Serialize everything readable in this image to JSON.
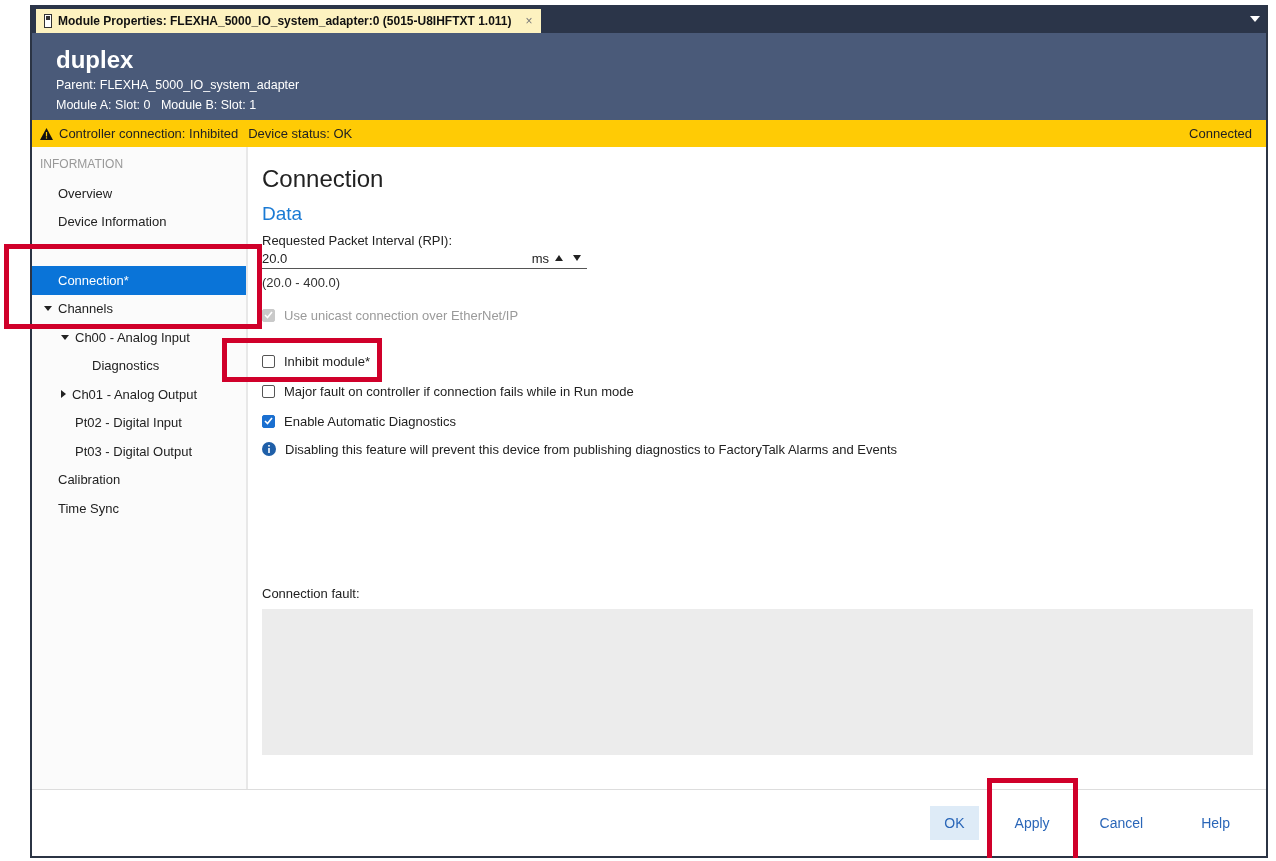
{
  "tab": {
    "title": "Module Properties:  FLEXHA_5000_IO_system_adapter:0 (5015-U8IHFTXT 1.011)",
    "close": "×"
  },
  "header": {
    "title": "duplex",
    "parent": "Parent: FLEXHA_5000_IO_system_adapter",
    "slots": "Module A: Slot: 0   Module B: Slot: 1"
  },
  "banner": {
    "controller": "Controller connection: Inhibited",
    "device": "Device status: OK",
    "connection": "Connected"
  },
  "sidebar": {
    "section": "INFORMATION",
    "items": [
      {
        "label": "Overview",
        "selected": false,
        "highlighted": false
      },
      {
        "label": "Device Information",
        "selected": false,
        "highlighted": false
      },
      {
        "label": "Connection*",
        "selected": true,
        "highlighted": true
      },
      {
        "label": "Channels",
        "selected": false,
        "highlighted": false,
        "expanded": true,
        "children": [
          {
            "label": "Ch00 - Analog Input",
            "selected": false,
            "highlighted": false,
            "expanded": true,
            "children": [
              {
                "label": "Diagnostics",
                "selected": false,
                "highlighted": false
              }
            ]
          },
          {
            "label": "Ch01 - Analog Output",
            "selected": false,
            "highlighted": false,
            "expanded": false
          },
          {
            "label": "Pt02 - Digital Input",
            "selected": false,
            "highlighted": false
          },
          {
            "label": "Pt03 - Digital Output",
            "selected": false,
            "highlighted": false
          }
        ]
      },
      {
        "label": "Calibration",
        "selected": false,
        "highlighted": false
      },
      {
        "label": "Time Sync",
        "selected": false,
        "highlighted": false
      }
    ]
  },
  "content": {
    "title": "Connection",
    "section": "Data",
    "rpi": {
      "label": "Requested Packet Interval (RPI):",
      "value": "20.0",
      "unit": "ms",
      "range": "(20.0 - 400.0)"
    },
    "options": [
      {
        "kind": "checkbox",
        "label": "Use unicast connection over EtherNet/IP",
        "checked": true,
        "disabled": true,
        "highlighted": false
      },
      {
        "kind": "checkbox",
        "label": "Inhibit module*",
        "checked": false,
        "disabled": false,
        "highlighted": true
      },
      {
        "kind": "checkbox",
        "label": "Major fault on controller if connection fails while in Run mode",
        "checked": false,
        "disabled": false,
        "highlighted": false
      },
      {
        "kind": "checkbox",
        "label": "Enable Automatic Diagnostics",
        "checked": true,
        "disabled": false,
        "highlighted": false
      },
      {
        "kind": "info",
        "label": "Disabling this feature will prevent this device from publishing diagnostics to FactoryTalk Alarms and Events"
      }
    ],
    "fault_label": "Connection fault:"
  },
  "buttons": [
    {
      "label": "OK",
      "default": true,
      "highlighted": false
    },
    {
      "label": "Apply",
      "default": false,
      "highlighted": true
    },
    {
      "label": "Cancel",
      "default": false,
      "highlighted": false
    },
    {
      "label": "Help",
      "default": false,
      "highlighted": false
    }
  ]
}
